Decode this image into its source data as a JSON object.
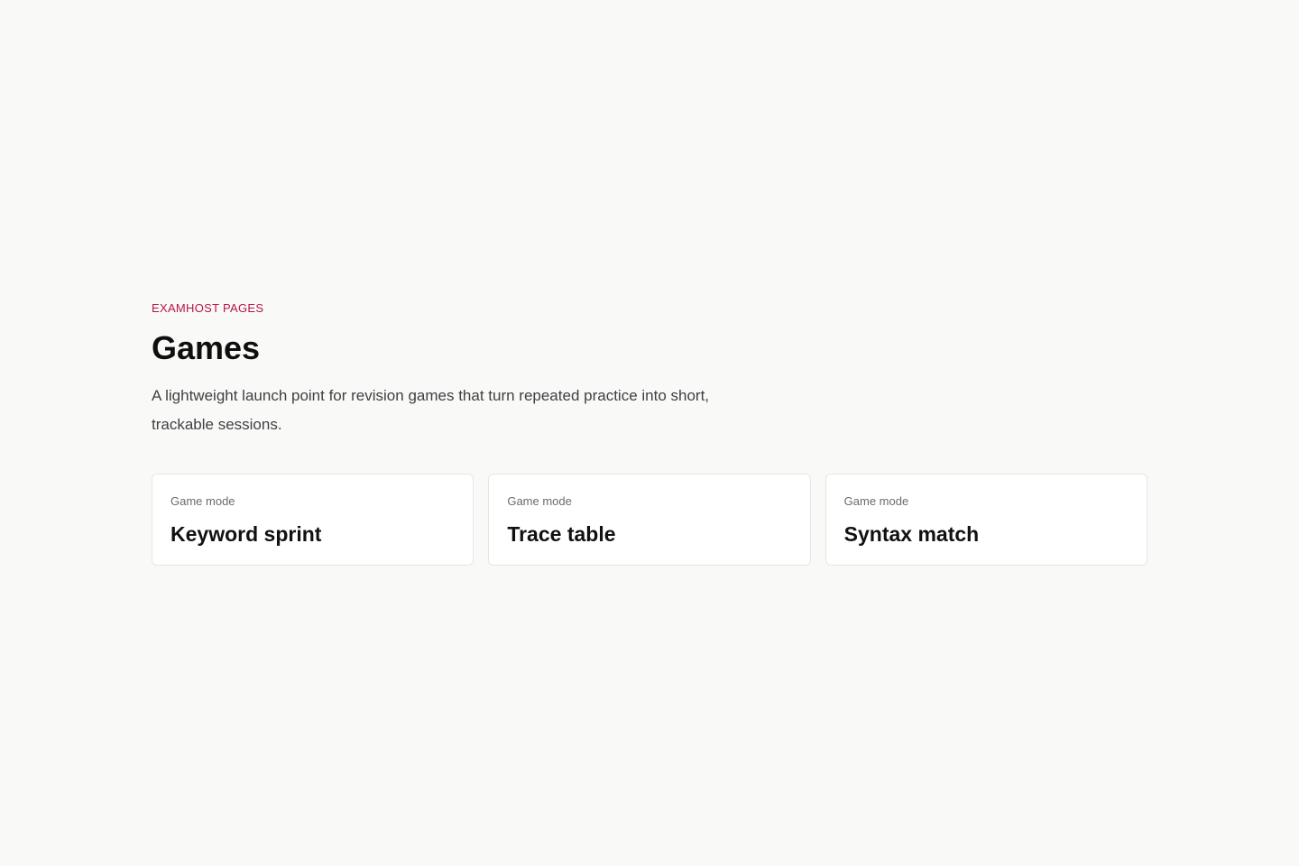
{
  "header": {
    "eyebrow": "EXAMHOST PAGES",
    "title": "Games",
    "subtitle": "A lightweight launch point for revision games that turn repeated practice into short, trackable sessions."
  },
  "cards": [
    {
      "kicker": "Game mode",
      "title": "Keyword sprint"
    },
    {
      "kicker": "Game mode",
      "title": "Trace table"
    },
    {
      "kicker": "Game mode",
      "title": "Syntax match"
    }
  ],
  "colors": {
    "accent": "#b5164a",
    "background": "#f9f9f8",
    "card_background": "#ffffff",
    "card_border": "#e6e6e4"
  }
}
